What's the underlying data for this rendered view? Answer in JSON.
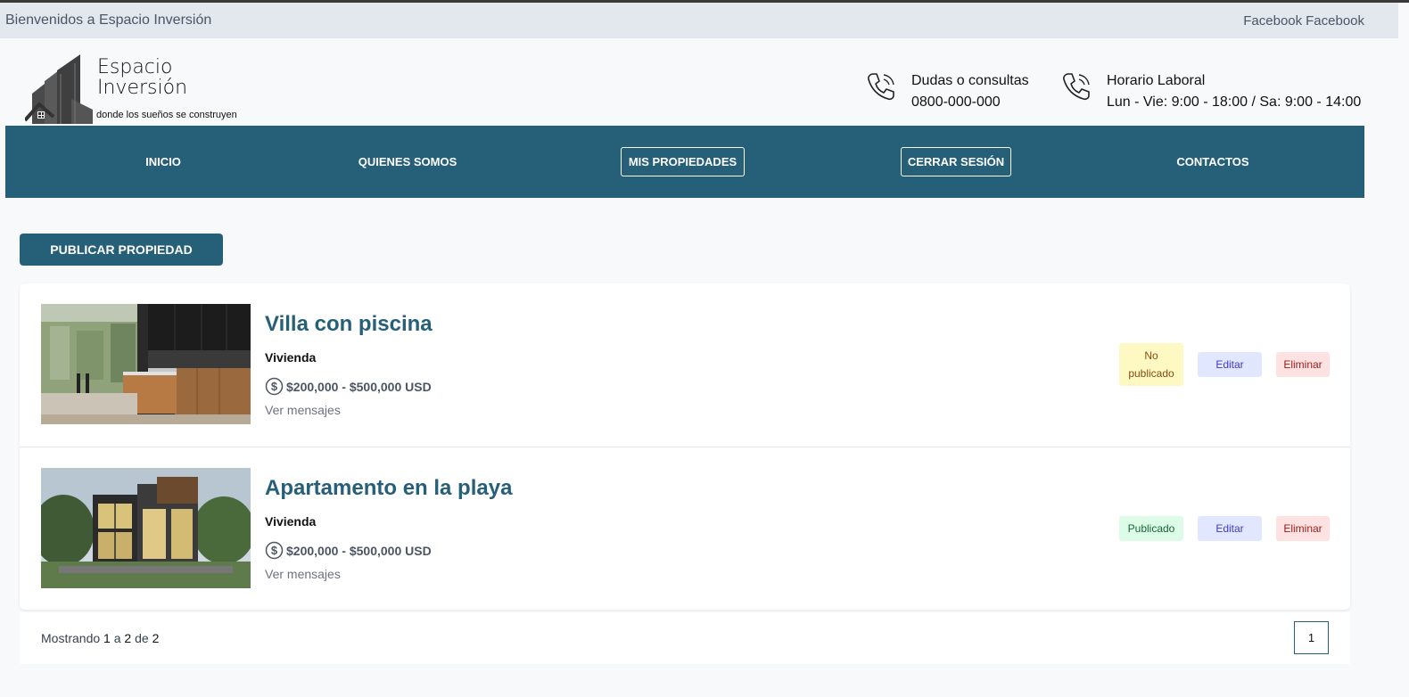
{
  "topbar": {
    "welcome": "Bienvenidos a Espacio Inversión",
    "links": [
      "Facebook",
      "Facebook"
    ]
  },
  "brand": {
    "name_line1": "Espacio",
    "name_line2": "Inversión",
    "tagline": "donde los sueños se construyen"
  },
  "contacts": [
    {
      "title": "Dudas o consultas",
      "value": "0800-000-000",
      "icon": "phone-icon"
    },
    {
      "title": "Horario Laboral",
      "value": "Lun - Vie: 9:00 - 18:00 / Sa: 9:00 - 14:00",
      "icon": "phone-icon"
    }
  ],
  "nav": {
    "items": [
      {
        "label": "Inicio"
      },
      {
        "label": "Quienes somos"
      },
      {
        "label": "Mis propiedades"
      },
      {
        "label": "Cerrar sesión"
      },
      {
        "label": "Contactos"
      }
    ]
  },
  "actions": {
    "publish_label": "Publicar Propiedad"
  },
  "properties": [
    {
      "title": "Villa con piscina",
      "type": "Vivienda",
      "price": "$200,000 - $500,000 USD",
      "messages_link": "Ver mensajes",
      "status": "No publicado",
      "edit_label": "Editar",
      "delete_label": "Eliminar"
    },
    {
      "title": "Apartamento en la playa",
      "type": "Vivienda",
      "price": "$200,000 - $500,000 USD",
      "messages_link": "Ver mensajes",
      "status": "Publicado",
      "edit_label": "Editar",
      "delete_label": "Eliminar"
    }
  ],
  "pagination": {
    "prefix": "Mostrando",
    "from": "1",
    "to_word": "a",
    "to": "2",
    "of_word": "de",
    "total": "2",
    "current_page": "1"
  },
  "colors": {
    "brand": "#265f78",
    "topbar": "#e3e8ef",
    "unpublished_bg": "#fef9c3",
    "published_bg": "#dcfce7",
    "edit_bg": "#e0e7ff",
    "delete_bg": "#fee2e2"
  }
}
